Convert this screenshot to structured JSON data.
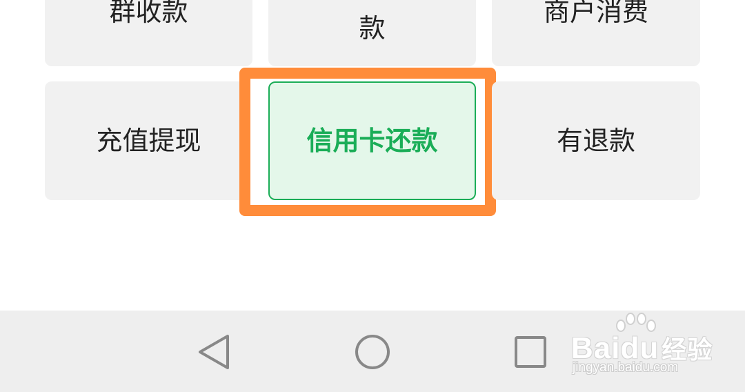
{
  "grid": {
    "tiles": [
      {
        "label": "群收款"
      },
      {
        "label": "款"
      },
      {
        "label": "商户消费"
      },
      {
        "label": "充值提现"
      },
      {
        "label": "信用卡还款"
      },
      {
        "label": "有退款"
      }
    ],
    "selected_index": 4
  },
  "colors": {
    "highlight": "#ff8c3a",
    "selected_text": "#1aad57",
    "selected_bg": "#e4f7ea",
    "tile_bg": "#f1f1f1"
  },
  "navbar": {
    "back": {
      "icon": "triangle-back-icon"
    },
    "home": {
      "icon": "circle-home-icon"
    },
    "recent": {
      "icon": "square-recent-icon"
    }
  },
  "watermark": {
    "brand": "Baidu",
    "brand_cn": "经验",
    "url": "jingyan.baidu.com"
  }
}
